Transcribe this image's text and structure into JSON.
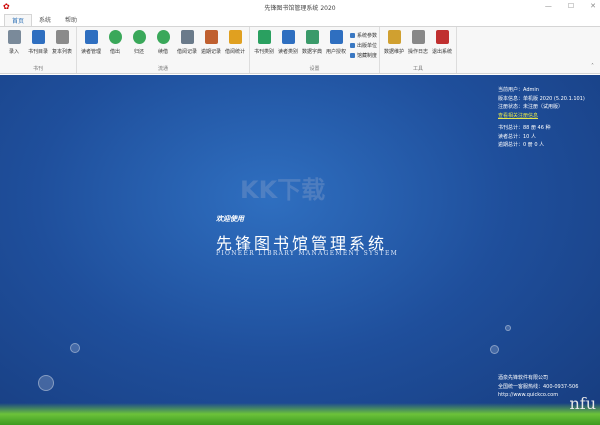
{
  "window": {
    "title": "先锋图书馆管理系统 2020"
  },
  "tabs": [
    "首页",
    "系统",
    "帮助"
  ],
  "ribbon": {
    "groups": [
      {
        "name": "书刊",
        "buttons": [
          "录入",
          "书刊目录",
          "复本列表"
        ]
      },
      {
        "name": "流通",
        "buttons": [
          "读者管理",
          "借出",
          "归还",
          "续借",
          "借阅记录",
          "逾期记录",
          "借阅统计"
        ]
      },
      {
        "name": "设置",
        "buttons": [
          "书刊类别",
          "读者类别",
          "数据字典",
          "用户授权"
        ],
        "small": [
          "系统参数",
          "出版单位",
          "馆藏制度"
        ]
      },
      {
        "name": "工具",
        "buttons": [
          "数据维护",
          "操作日志",
          "退出系统"
        ]
      }
    ]
  },
  "colors": {
    "accent": "#2a6fb5",
    "background": "#1f4f9c",
    "link": "#e6e64a"
  },
  "main": {
    "welcome": "欢迎使用",
    "title": "先锋图书馆管理系统",
    "subtitle": "PIONEER LIBRARY MANAGEMENT SYSTEM",
    "watermark": "KK下载",
    "info": {
      "user": "当前用户：Admin",
      "version": "版本信息：单机版 2020 (5.20.1.101)",
      "reg": "注册状态：未注册（试用版）",
      "reg_link": "查看相关注册信息",
      "books": "书刊总计：88 册 46 种",
      "readers": "读者总计：10 人",
      "overdue": "逾期总计：0 册 0 人"
    },
    "footer": {
      "company": "酒泉先锋软件有限公司",
      "hotline": "全国统一客服热线：400-0937-506",
      "url": "http://www.quickco.com"
    },
    "corner_mark": "nfu"
  }
}
